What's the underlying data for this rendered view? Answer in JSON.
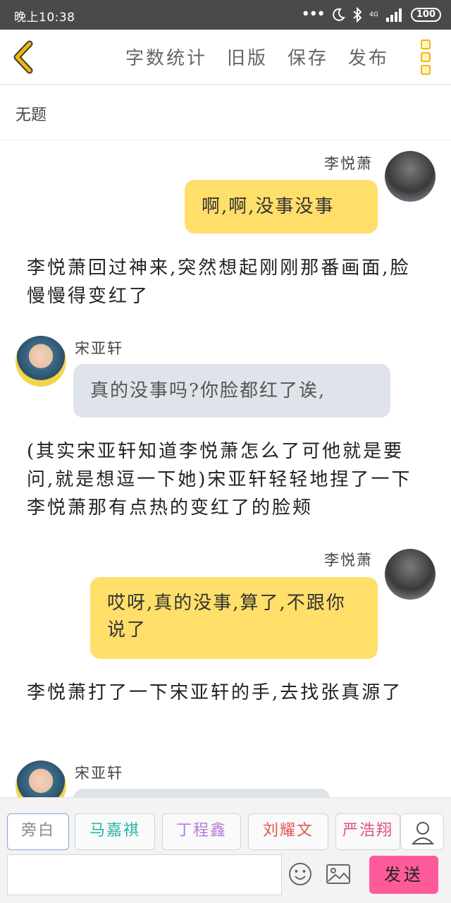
{
  "status_bar": {
    "time": "晚上10:38",
    "network": "4G",
    "battery": "100",
    "dots": "•••"
  },
  "toolbar": {
    "actions": [
      "字数统计",
      "旧版",
      "保存",
      "发布"
    ]
  },
  "document": {
    "title": "无题"
  },
  "messages": [
    {
      "speaker": "李悦萧",
      "side": "right",
      "text": "啊,啊,没事没事"
    },
    {
      "narration": "李悦萧回过神来,突然想起刚刚那番画面,脸慢慢得变红了"
    },
    {
      "speaker": "宋亚轩",
      "side": "left",
      "text": "真的没事吗?你脸都红了诶,"
    },
    {
      "narration": "(其实宋亚轩知道李悦萧怎么了可他就是要问,就是想逗一下她)宋亚轩轻轻地捏了一下李悦萧那有点热的变红了的脸颊"
    },
    {
      "speaker": "李悦萧",
      "side": "right",
      "text": "哎呀,真的没事,算了,不跟你说了"
    },
    {
      "narration": "李悦萧打了一下宋亚轩的手,去找张真源了"
    },
    {
      "speaker": "宋亚轩",
      "side": "left",
      "text": ""
    }
  ],
  "roles": [
    {
      "name": "旁白",
      "color": "#888888",
      "active": true
    },
    {
      "name": "马嘉祺",
      "color": "#2ab3a6",
      "active": false
    },
    {
      "name": "丁程鑫",
      "color": "#b67ad6",
      "active": false
    },
    {
      "name": "刘耀文",
      "color": "#e0584f",
      "active": false
    },
    {
      "name": "严浩翔",
      "color": "#e0508a",
      "active": false
    }
  ],
  "composer": {
    "input_value": "",
    "send_label": "发送"
  },
  "colors": {
    "accent_yellow": "#ffdf6a",
    "bubble_gray": "#dfe3ea",
    "send_pink": "#ff5b9a",
    "back_arrow": "#f0b800"
  }
}
